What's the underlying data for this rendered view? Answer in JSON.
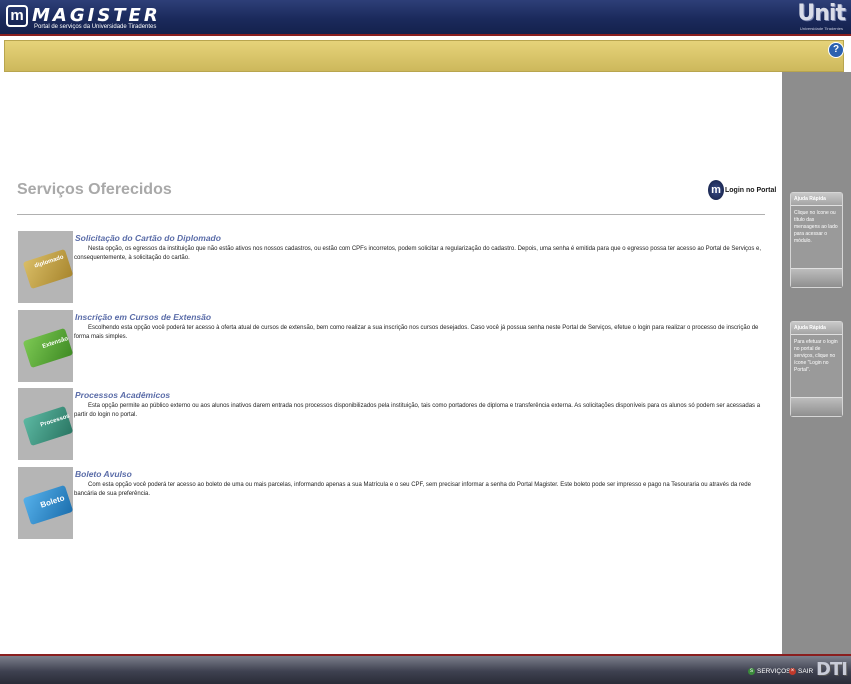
{
  "header": {
    "logo_text": "MAGISTER",
    "logo_mark": "m",
    "logo_subtitle": "Portal de serviços da Universidade Tiradentes",
    "right_logo": "Unit",
    "right_logo_subtitle": "Universidade Tiradentes"
  },
  "help": {
    "label": "?"
  },
  "page": {
    "title": "Serviços Oferecidos",
    "login_icon": "m",
    "login_label": "Login no Portal"
  },
  "services": [
    {
      "title": "Solicitação do Cartão do Diplomado",
      "description": "Nesta opção, os egressos da instituição que não estão ativos nos nossos cadastros, ou estão com CPFs incorretos, podem solicitar a regularização do cadastro. Depois, uma senha é emitida para que o egresso possa ter acesso ao Portal de Serviços e, consequentemente, à solicitação do cartão.",
      "image_label": "diplomado",
      "icon": "graduate-card-icon",
      "color": "#c8a64a"
    },
    {
      "title": "Inscrição em Cursos de Extensão",
      "description": "Escolhendo esta opção você poderá ter acesso à oferta atual de cursos de extensão, bem como realizar a sua inscrição nos cursos desejados. Caso você já possua senha neste Portal de Serviços, efetue o login para realizar o processo de inscrição de forma mais simples.",
      "image_label": "Extensão",
      "icon": "extension-card-icon",
      "color": "#5fae3c"
    },
    {
      "title": "Processos Acadêmicos",
      "description": "Esta opção permite ao público externo ou aos alunos inativos darem entrada nos processos disponibilizados pela instituição, tais como portadores de diploma e transferência externa. As solicitações disponíveis para os alunos só podem ser acessadas a partir do login no portal.",
      "image_label": "Processos",
      "icon": "processes-card-icon",
      "color": "#3f9a86"
    },
    {
      "title": "Boleto Avulso",
      "description": "Com esta opção você poderá ter acesso ao boleto de uma ou mais parcelas, informando apenas a sua Matrícula e o seu CPF, sem precisar informar a senha do Portal Magister. Este boleto pode ser impresso e pago na Tesouraria ou através da rede bancária de sua preferência.",
      "image_label": "Boleto",
      "icon": "boleto-card-icon",
      "color": "#2f8fd0"
    }
  ],
  "sidebar": {
    "tips": [
      {
        "title": "Ajuda Rápida",
        "text": "Clique no ícone ou título das mensagens ao lado para acessar o módulo."
      },
      {
        "title": "Ajuda Rápida",
        "text": "Para efetuar o login no portal de serviços, clique no ícone \"Login no Portal\"."
      }
    ]
  },
  "footer": {
    "services_label": "SERVIÇOS",
    "exit_label": "SAIR",
    "dti_logo": "DTI"
  }
}
